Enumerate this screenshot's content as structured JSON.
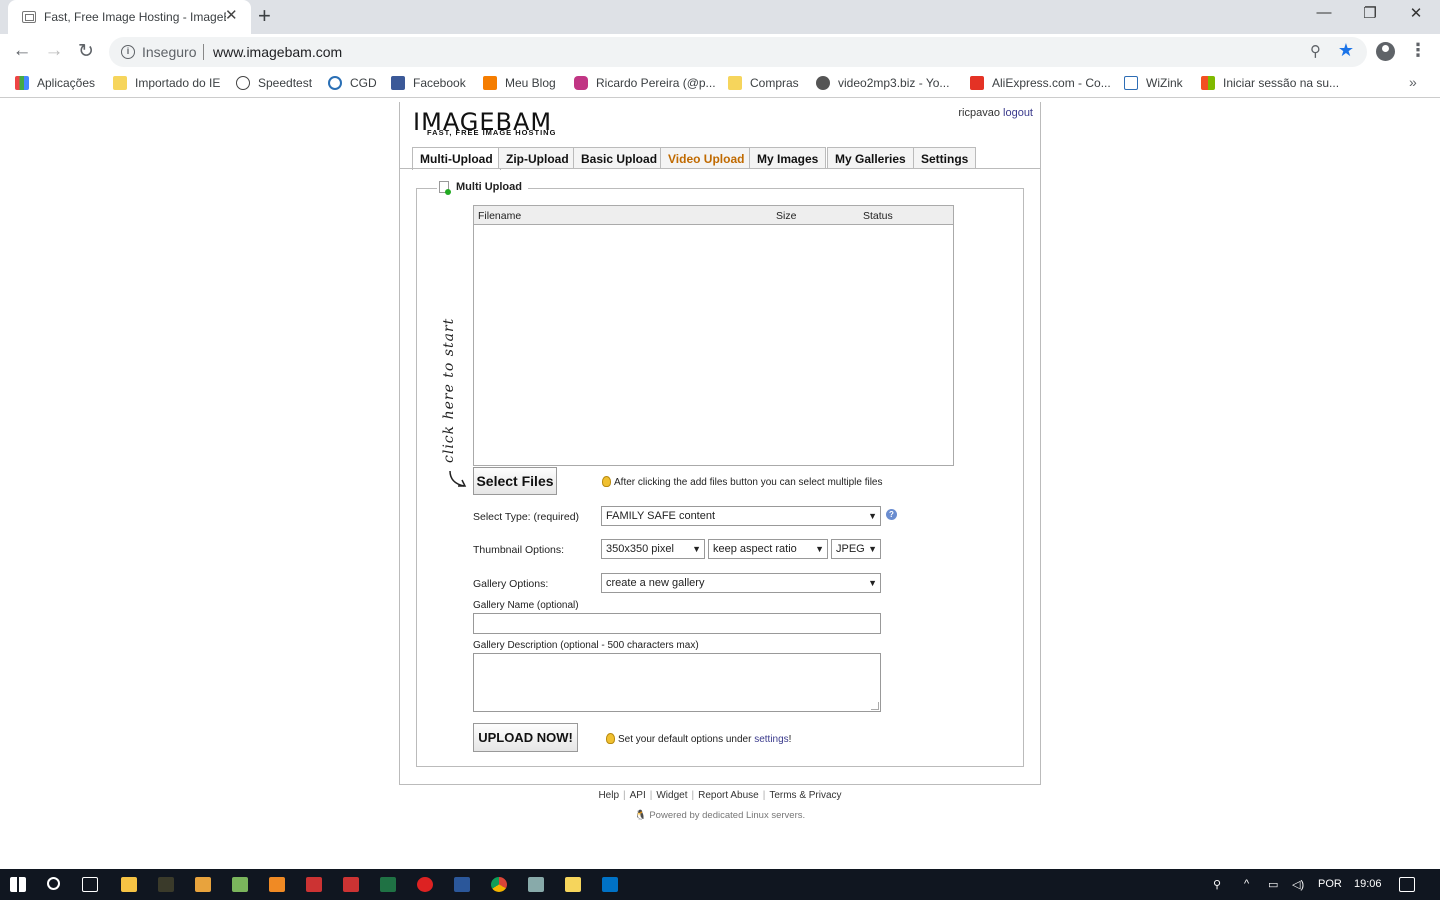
{
  "browser": {
    "tab_title": "Fast, Free Image Hosting - ImageBam",
    "security_label": "Inseguro",
    "url": "www.imagebam.com",
    "bookmarks": [
      {
        "label": "Aplicações",
        "color": "#e44"
      },
      {
        "label": "Importado do IE",
        "color": "#f6d55c"
      },
      {
        "label": "Speedtest",
        "color": "#444"
      },
      {
        "label": "CGD",
        "color": "#2a6fb5"
      },
      {
        "label": "Facebook",
        "color": "#3b5998"
      },
      {
        "label": "Meu Blog",
        "color": "#f57d00"
      },
      {
        "label": "Ricardo Pereira (@p...",
        "color": "#c13584"
      },
      {
        "label": "Compras",
        "color": "#f6d55c"
      },
      {
        "label": "video2mp3.biz - Yo...",
        "color": "#555"
      },
      {
        "label": "AliExpress.com - Co...",
        "color": "#e43225"
      },
      {
        "label": "WiZink",
        "color": "#2d6db5"
      },
      {
        "label": "Iniciar sessão na su...",
        "color": "#2aa5e0"
      }
    ]
  },
  "site": {
    "logo": "IMAGEBAM",
    "tagline": "FAST, FREE IMAGE HOSTING",
    "username": "ricpavao",
    "logout": "logout",
    "tabs": [
      "Multi-Upload",
      "Zip-Upload",
      "Basic Upload",
      "Video Upload",
      "My Images",
      "My Galleries",
      "Settings"
    ],
    "section_title": "Multi Upload",
    "columns": {
      "filename": "Filename",
      "size": "Size",
      "status": "Status"
    },
    "click_hint": "click here to start",
    "select_files": "Select Files",
    "multi_hint": "After clicking the add files button you can select multiple files",
    "select_type_label": "Select Type: (required)",
    "select_type_value": "FAMILY SAFE content",
    "thumb_label": "Thumbnail Options:",
    "thumb_size": "350x350 pixel",
    "thumb_aspect": "keep aspect ratio",
    "thumb_format": "JPEG",
    "gallery_label": "Gallery Options:",
    "gallery_value": "create a new gallery",
    "gallery_name_label": "Gallery Name (optional)",
    "gallery_desc_label": "Gallery Description (optional - 500 characters max)",
    "upload_button": "UPLOAD NOW!",
    "default_hint_pre": "Set your default options under ",
    "default_hint_link": "settings",
    "default_hint_post": "!",
    "footer_links": [
      "Help",
      "API",
      "Widget",
      "Report Abuse",
      "Terms & Privacy"
    ],
    "powered": "Powered by dedicated Linux servers."
  },
  "taskbar": {
    "language": "POR",
    "time": "19:06"
  }
}
